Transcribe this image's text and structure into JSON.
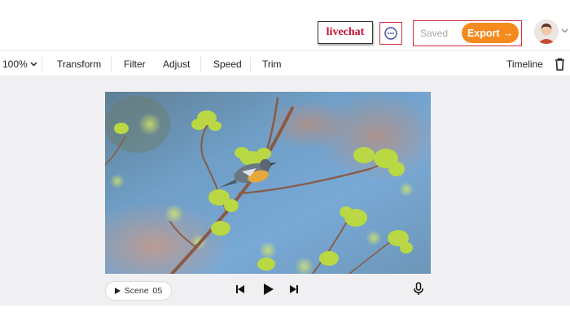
{
  "header": {
    "livechat_label": "livechat",
    "saved_label": "Saved",
    "export_label": "Export",
    "export_arrow": "→",
    "icons": {
      "chat": "chat-bubble-icon",
      "avatar": "user-avatar",
      "menu": "chevron-down-icon"
    }
  },
  "toolbar": {
    "zoom": "100%",
    "tools": [
      "Transform",
      "Filter",
      "Adjust",
      "Speed",
      "Trim"
    ],
    "timeline_label": "Timeline",
    "delete_icon": "trash-icon"
  },
  "player": {
    "scene_label": "Scene",
    "scene_number": "05",
    "icons": [
      "skip-back-icon",
      "play-icon",
      "skip-forward-icon",
      "microphone-icon"
    ]
  },
  "colors": {
    "accent": "#f58a1f",
    "livechat_text": "#c8102e",
    "highlight_border": "#d62b3b",
    "workspace_bg": "#f0f0f2"
  }
}
